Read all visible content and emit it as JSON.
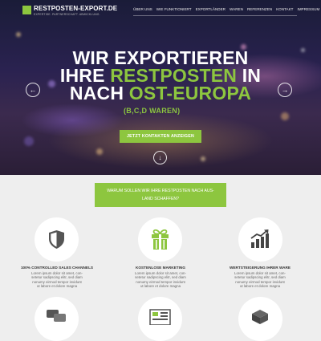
{
  "logo": {
    "title": "RESTPOSTEN-EXPORT.DE",
    "subtitle": "EXPERTISE. PARTNERSCHAFT. ABWICKLUNG."
  },
  "nav": {
    "items": [
      "ÜBER UNS",
      "WIE FUNKTIONIERT",
      "EXPORTLÄNDER",
      "WAREN",
      "REFERENZEN",
      "KONTAKT",
      "IMPRESSUM"
    ]
  },
  "hero": {
    "line1": "WIR EXPORTIEREN",
    "line2_a": "IHRE ",
    "line2_highlight": "RESTPOSTEN",
    "line2_b": " IN",
    "line3_a": "NACH ",
    "line3_highlight": "OST-EUROPA",
    "subline": "(B,C,D WAREN)",
    "cta_label": "JETZT KONTAKTEN ANZEIGEN",
    "prev_icon": "arrow-left-icon",
    "next_icon": "arrow-right-icon",
    "down_icon": "arrow-down-icon"
  },
  "banner": {
    "line1": "WARUM SOLLEN WIR IHRE RESTPOSTEN NACH AUS-",
    "line2": "LAND SCHAFFEN?"
  },
  "features": [
    {
      "icon": "shield-icon",
      "title": "100% CONTROLLED SALES CHANNELS",
      "lines": [
        "Lorem ipsum dolor sit amet, con-",
        "setetur sadipscing elitr, sed diam",
        "nonumy eirmod tempor invidunt",
        "ut labore et dolore magna"
      ]
    },
    {
      "icon": "gift-icon",
      "title": "KOSTENLOSE MARKETING",
      "lines": [
        "Lorem ipsum dolor sit amet, con-",
        "setetur sadipscing elitr, sed diam",
        "nonumy eirmod tempor invidunt",
        "ut labore et dolore magna"
      ]
    },
    {
      "icon": "bar-chart-icon",
      "title": "WERTSTEIGERUNG IHRER WARE",
      "lines": [
        "Lorem ipsum dolor sit amet, con-",
        "setetur sadipscing elitr, sed diam",
        "nonumy eirmod tempor invidunt",
        "ut labore et dolore magna"
      ]
    }
  ],
  "features_row2_icons": [
    "chat-bubbles-icon",
    "sale-document-icon",
    "boxes-icon"
  ],
  "colors": {
    "accent": "#8dc63f",
    "hero_dark": "#1a1c38",
    "section_bg": "#eeeeee"
  }
}
